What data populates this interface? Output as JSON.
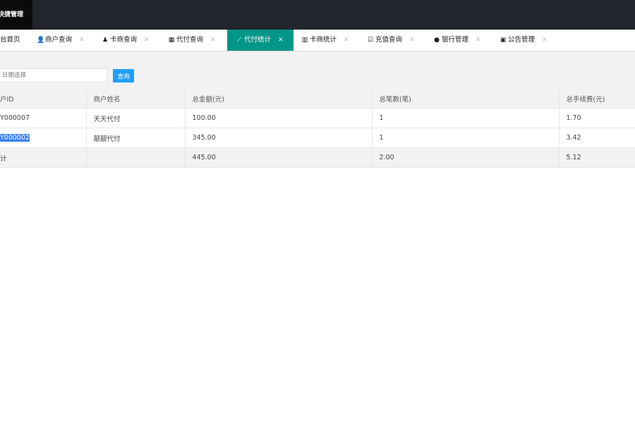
{
  "header": {
    "brand": "快捷管理"
  },
  "tabs": [
    {
      "label": "台首页",
      "icon": "",
      "closable": false
    },
    {
      "label": "商户查询",
      "icon": "user-icon",
      "closable": true
    },
    {
      "label": "卡商查询",
      "icon": "users-icon",
      "closable": true
    },
    {
      "label": "代付查询",
      "icon": "table-icon",
      "closable": true
    },
    {
      "label": "代付统计",
      "icon": "chart-icon",
      "closable": true,
      "active": true
    },
    {
      "label": "卡商统计",
      "icon": "bar-chart-icon",
      "closable": true
    },
    {
      "label": "充值查询",
      "icon": "shield-check-icon",
      "closable": true
    },
    {
      "label": "银行管理",
      "icon": "info-circle-icon",
      "closable": true
    },
    {
      "label": "公告管理",
      "icon": "calendar-icon",
      "closable": true
    }
  ],
  "search": {
    "date_placeholder": "日期选择",
    "query_label": "查询"
  },
  "table": {
    "columns": [
      "户ID",
      "商户姓名",
      "总金额(元)",
      "总笔数(笔)",
      "总手续费(元)"
    ],
    "rows": [
      [
        "Y000007",
        "天天代付",
        "100.00",
        "1",
        "1.70"
      ],
      [
        "Y000002",
        "靓靓代付",
        "345.00",
        "1",
        "3.42"
      ]
    ],
    "total": [
      "计",
      "",
      "445.00",
      "2.00",
      "5.12"
    ]
  },
  "colors": {
    "topbar": "#22252d",
    "active_tab": "#009688",
    "query_button": "#1e9fff",
    "selection": "#3b82f6"
  }
}
